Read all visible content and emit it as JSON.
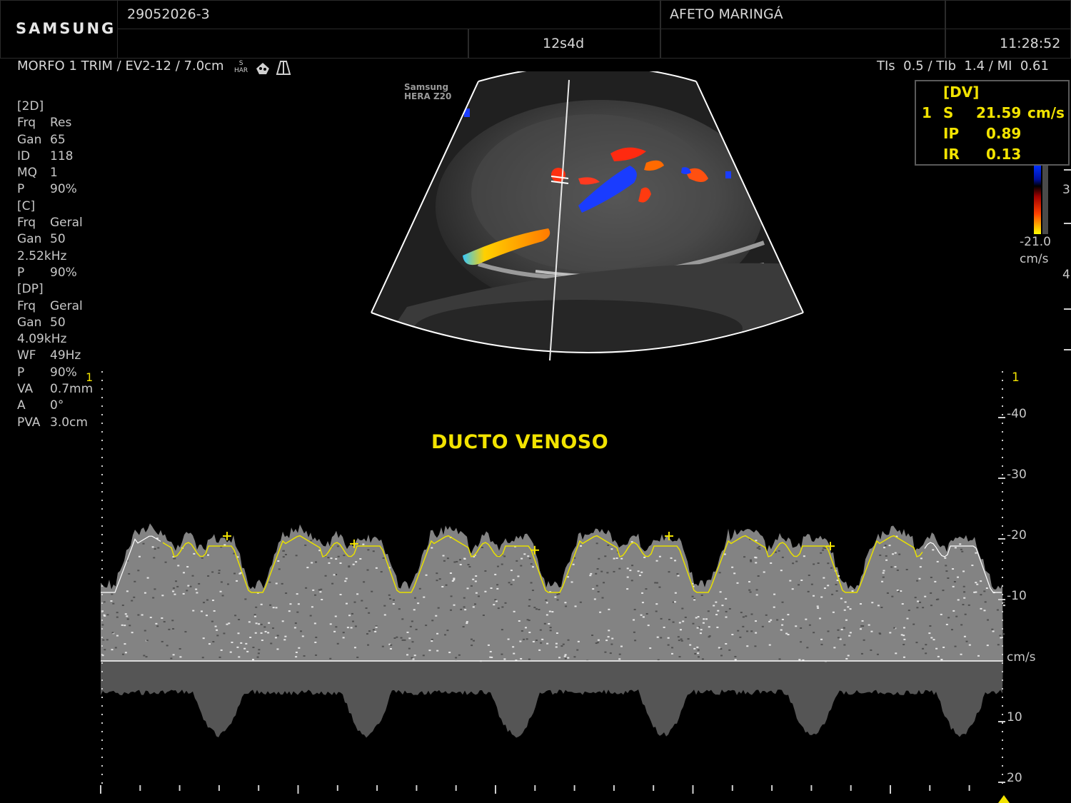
{
  "header": {
    "brand": "SAMSUNG",
    "patient_id": "29052026-3",
    "institution": "AFETO MARINGÁ",
    "gestational_age": "12s4d",
    "time": "11:28:52"
  },
  "preset_bar": {
    "preset": "MORFO 1 TRIM / EV2-12 / 7.0cm",
    "har_top": "S",
    "har_bottom": "HAR",
    "thermal": "TIs  0.5 / TIb  1.4 / MI  0.61"
  },
  "device_label": {
    "line1": "Samsung",
    "line2": "HERA Z20"
  },
  "params": [
    {
      "k": "[2D]",
      "v": ""
    },
    {
      "k": "Frq",
      "v": "Res"
    },
    {
      "k": "Gan",
      "v": "65"
    },
    {
      "k": "ID",
      "v": "118"
    },
    {
      "k": "MQ",
      "v": "1"
    },
    {
      "k": "P",
      "v": "90%"
    },
    {
      "k": "[C]",
      "v": ""
    },
    {
      "k": "Frq",
      "v": "Geral"
    },
    {
      "k": "Gan",
      "v": "50"
    },
    {
      "k": "2.52kHz",
      "v": ""
    },
    {
      "k": "P",
      "v": "90%"
    },
    {
      "k": "[DP]",
      "v": ""
    },
    {
      "k": "Frq",
      "v": "Geral"
    },
    {
      "k": "Gan",
      "v": "50"
    },
    {
      "k": "4.09kHz",
      "v": ""
    },
    {
      "k": "WF",
      "v": "49Hz"
    },
    {
      "k": "P",
      "v": "90%"
    },
    {
      "k": "VA",
      "v": "0.7mm"
    },
    {
      "k": "A",
      "v": "0°"
    },
    {
      "k": "PVA",
      "v": "3.0cm"
    }
  ],
  "measurement": {
    "label": "[DV]",
    "index": "1",
    "s_label": "S",
    "s_value": "21.59",
    "s_unit": "cm/s",
    "ip_label": "IP",
    "ip_value": "0.89",
    "ir_label": "IR",
    "ir_value": "0.13"
  },
  "color_scale": {
    "min": "-21.0",
    "unit": "cm/s",
    "partial_top": "3",
    "partial_bottom": "4"
  },
  "doppler": {
    "title": "DUCTO VENOSO",
    "gate_marker": "1",
    "scale_marker": "1",
    "scale_labels": [
      "-40",
      "-30",
      "-20",
      "-10",
      "cm/s",
      "10",
      "20"
    ],
    "baseline_label": "cm/s"
  },
  "colors": {
    "measurement": "#f2e300",
    "trace": "#e8e000",
    "baseline": "#ffffff"
  }
}
